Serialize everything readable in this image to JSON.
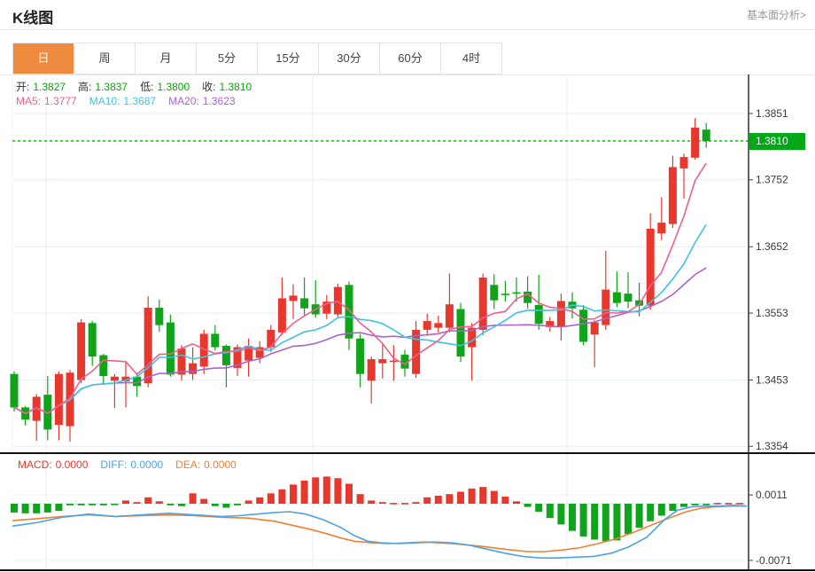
{
  "header": {
    "title": "K线图",
    "link": "基本面分析>"
  },
  "tabs": [
    {
      "label": "日",
      "active": true
    },
    {
      "label": "周",
      "active": false
    },
    {
      "label": "月",
      "active": false
    },
    {
      "label": "5分",
      "active": false
    },
    {
      "label": "15分",
      "active": false
    },
    {
      "label": "30分",
      "active": false
    },
    {
      "label": "60分",
      "active": false
    },
    {
      "label": "4时",
      "active": false
    }
  ],
  "ohlc_items": [
    {
      "label": "开:",
      "value": "1.3827"
    },
    {
      "label": "高:",
      "value": "1.3837"
    },
    {
      "label": "低:",
      "value": "1.3800"
    },
    {
      "label": "收:",
      "value": "1.3810"
    }
  ],
  "ohlc_value_color": "#0aa50a",
  "ma_legend": [
    {
      "label": "MA5:",
      "value": "1.3777",
      "color": "#ef5f8e"
    },
    {
      "label": "MA10:",
      "value": "1.3687",
      "color": "#3fc3e3"
    },
    {
      "label": "MA20:",
      "value": "1.3623",
      "color": "#ab63ce"
    }
  ],
  "macd_legend": [
    {
      "label": "MACD:",
      "value": "0.0000",
      "color": "#e8372c"
    },
    {
      "label": "DIFF:",
      "value": "0.0000",
      "color": "#4da2e8"
    },
    {
      "label": "DEA:",
      "value": "0.0000",
      "color": "#f08030"
    }
  ],
  "price_axis": {
    "labels": [
      "1.3851",
      "1.3752",
      "1.3652",
      "1.3553",
      "1.3453",
      "1.3354"
    ],
    "current_price": "1.3810"
  },
  "macd_axis": {
    "labels": [
      "0.0011",
      "-0.0071"
    ]
  },
  "colors": {
    "up": "#e8382d",
    "down": "#10a41b",
    "ma5": "#ef5f8e",
    "ma10": "#3fc3e3",
    "ma20": "#ab63ce",
    "diff": "#4da2e8",
    "dea": "#f08030",
    "tab_active_bg": "#ee8b3e",
    "price_tag_bg": "#00a716",
    "current_line": "#2eba2e",
    "grid": "#e9eef5",
    "axis": "#222222",
    "zero_line": "#b8dcf5"
  },
  "chart_data": {
    "type": "candlestick",
    "title": "K线图",
    "panes": 2,
    "pane1": {
      "ylabel": "price",
      "y_ticks": [
        1.3851,
        1.3752,
        1.3652,
        1.3553,
        1.3453,
        1.3354
      ],
      "current_price": 1.381,
      "ma_windows": [
        5,
        10,
        20
      ],
      "candles_ohlc": [
        [
          1.3462,
          1.3466,
          1.3406,
          1.3412
        ],
        [
          1.3412,
          1.3414,
          1.3385,
          1.3394
        ],
        [
          1.3392,
          1.3432,
          1.3362,
          1.3428
        ],
        [
          1.3431,
          1.3459,
          1.3363,
          1.3379
        ],
        [
          1.3386,
          1.3466,
          1.3363,
          1.3462
        ],
        [
          1.3384,
          1.3468,
          1.3361,
          1.3464
        ],
        [
          1.3453,
          1.3544,
          1.3448,
          1.3539
        ],
        [
          1.3538,
          1.3541,
          1.3474,
          1.3488
        ],
        [
          1.349,
          1.3492,
          1.3446,
          1.3459
        ],
        [
          1.3452,
          1.3462,
          1.3411,
          1.3458
        ],
        [
          1.3451,
          1.3479,
          1.3412,
          1.3458
        ],
        [
          1.3458,
          1.3464,
          1.3428,
          1.3444
        ],
        [
          1.3448,
          1.3578,
          1.3442,
          1.3561
        ],
        [
          1.3561,
          1.3573,
          1.3525,
          1.3535
        ],
        [
          1.3539,
          1.3551,
          1.3458,
          1.3461
        ],
        [
          1.3461,
          1.3505,
          1.3452,
          1.35
        ],
        [
          1.3462,
          1.3502,
          1.3453,
          1.3478
        ],
        [
          1.3473,
          1.3528,
          1.3462,
          1.3522
        ],
        [
          1.3522,
          1.3535,
          1.3497,
          1.3502
        ],
        [
          1.3504,
          1.3506,
          1.3442,
          1.3475
        ],
        [
          1.3471,
          1.3506,
          1.3459,
          1.3502
        ],
        [
          1.3482,
          1.3515,
          1.3458,
          1.3504
        ],
        [
          1.3486,
          1.3511,
          1.3478,
          1.3502
        ],
        [
          1.3502,
          1.3535,
          1.3495,
          1.3528
        ],
        [
          1.3524,
          1.3606,
          1.352,
          1.3575
        ],
        [
          1.3571,
          1.3596,
          1.3544,
          1.3579
        ],
        [
          1.3575,
          1.3606,
          1.355,
          1.356
        ],
        [
          1.3566,
          1.3602,
          1.3546,
          1.3551
        ],
        [
          1.3552,
          1.358,
          1.3544,
          1.357
        ],
        [
          1.3551,
          1.3597,
          1.3545,
          1.3592
        ],
        [
          1.3595,
          1.36,
          1.3498,
          1.3515
        ],
        [
          1.3515,
          1.3522,
          1.3442,
          1.3462
        ],
        [
          1.3452,
          1.3488,
          1.3418,
          1.3484
        ],
        [
          1.3478,
          1.3506,
          1.3455,
          1.3484
        ],
        [
          1.348,
          1.3505,
          1.3452,
          1.3482
        ],
        [
          1.3491,
          1.3498,
          1.3458,
          1.347
        ],
        [
          1.3462,
          1.3541,
          1.3456,
          1.3528
        ],
        [
          1.3528,
          1.3552,
          1.352,
          1.3541
        ],
        [
          1.3531,
          1.3549,
          1.3524,
          1.3538
        ],
        [
          1.3531,
          1.3612,
          1.3524,
          1.3566
        ],
        [
          1.3559,
          1.3568,
          1.348,
          1.3488
        ],
        [
          1.3502,
          1.3538,
          1.3452,
          1.3531
        ],
        [
          1.3528,
          1.3612,
          1.352,
          1.3606
        ],
        [
          1.3595,
          1.3611,
          1.3559,
          1.3572
        ],
        [
          1.3582,
          1.3601,
          1.357,
          1.358
        ],
        [
          1.3584,
          1.3606,
          1.357,
          1.3582
        ],
        [
          1.3585,
          1.3608,
          1.356,
          1.3568
        ],
        [
          1.3565,
          1.361,
          1.3528,
          1.3537
        ],
        [
          1.3532,
          1.3547,
          1.3525,
          1.3541
        ],
        [
          1.3532,
          1.3582,
          1.3512,
          1.3571
        ],
        [
          1.357,
          1.3584,
          1.3545,
          1.356
        ],
        [
          1.3558,
          1.3565,
          1.3505,
          1.351
        ],
        [
          1.3521,
          1.3542,
          1.3472,
          1.3539
        ],
        [
          1.3535,
          1.3646,
          1.3528,
          1.3588
        ],
        [
          1.3584,
          1.3615,
          1.3562,
          1.3568
        ],
        [
          1.3582,
          1.3614,
          1.356,
          1.357
        ],
        [
          1.3572,
          1.3598,
          1.3548,
          1.3564
        ],
        [
          1.3564,
          1.3702,
          1.3558,
          1.3679
        ],
        [
          1.3672,
          1.3726,
          1.3662,
          1.3688
        ],
        [
          1.3686,
          1.3788,
          1.368,
          1.3771
        ],
        [
          1.3769,
          1.3791,
          1.3724,
          1.3786
        ],
        [
          1.3785,
          1.3844,
          1.3782,
          1.383
        ],
        [
          1.3827,
          1.3837,
          1.38,
          1.381
        ]
      ]
    },
    "pane2": {
      "indicator": "MACD",
      "y_ticks": [
        0.0011,
        -0.0071
      ],
      "hist_1e4": [
        -11,
        -12,
        -12,
        -11,
        -9,
        -2,
        -2,
        -2,
        -2,
        -1,
        4,
        2,
        8,
        3,
        -2,
        -3,
        13,
        6,
        -3,
        -5,
        -2,
        4,
        8,
        13,
        18,
        24,
        29,
        33,
        34,
        32,
        25,
        12,
        4,
        2,
        1,
        1,
        2,
        8,
        10,
        12,
        15,
        19,
        21,
        16,
        9,
        3,
        -4,
        -10,
        -18,
        -26,
        -34,
        -41,
        -45,
        -47,
        -46,
        -38,
        -30,
        -22,
        -15,
        -9,
        -4,
        -2,
        -1,
        1,
        1,
        1
      ],
      "diff_points_1e4": [
        [
          14,
          -28
        ],
        [
          40,
          -24
        ],
        [
          70,
          -17
        ],
        [
          100,
          -13
        ],
        [
          130,
          -16
        ],
        [
          160,
          -14
        ],
        [
          190,
          -12
        ],
        [
          220,
          -14
        ],
        [
          250,
          -16
        ],
        [
          270,
          -15
        ],
        [
          290,
          -13
        ],
        [
          310,
          -11
        ],
        [
          327,
          -10
        ],
        [
          345,
          -13
        ],
        [
          365,
          -20
        ],
        [
          385,
          -30
        ],
        [
          400,
          -40
        ],
        [
          415,
          -47
        ],
        [
          430,
          -49
        ],
        [
          450,
          -50
        ],
        [
          470,
          -49
        ],
        [
          490,
          -48
        ],
        [
          510,
          -49
        ],
        [
          530,
          -52
        ],
        [
          550,
          -57
        ],
        [
          570,
          -62
        ],
        [
          590,
          -66
        ],
        [
          610,
          -68
        ],
        [
          630,
          -68
        ],
        [
          650,
          -67
        ],
        [
          670,
          -66
        ],
        [
          690,
          -62
        ],
        [
          710,
          -54
        ],
        [
          730,
          -42
        ],
        [
          750,
          -20
        ],
        [
          765,
          -8
        ],
        [
          780,
          -4
        ],
        [
          797,
          -3
        ],
        [
          812,
          -3
        ],
        [
          828,
          -2
        ],
        [
          843,
          -3
        ]
      ],
      "dea_points_1e4": [
        [
          14,
          -21
        ],
        [
          40,
          -19
        ],
        [
          70,
          -16
        ],
        [
          100,
          -14
        ],
        [
          130,
          -16
        ],
        [
          160,
          -15
        ],
        [
          190,
          -14
        ],
        [
          220,
          -15
        ],
        [
          250,
          -17
        ],
        [
          280,
          -18
        ],
        [
          310,
          -22
        ],
        [
          330,
          -27
        ],
        [
          350,
          -32
        ],
        [
          370,
          -38
        ],
        [
          385,
          -43
        ],
        [
          400,
          -47
        ],
        [
          420,
          -49
        ],
        [
          440,
          -50
        ],
        [
          460,
          -49
        ],
        [
          480,
          -48
        ],
        [
          510,
          -50
        ],
        [
          540,
          -53
        ],
        [
          570,
          -57
        ],
        [
          595,
          -60
        ],
        [
          615,
          -60
        ],
        [
          635,
          -58
        ],
        [
          655,
          -55
        ],
        [
          675,
          -50
        ],
        [
          695,
          -44
        ],
        [
          715,
          -36
        ],
        [
          735,
          -27
        ],
        [
          755,
          -18
        ],
        [
          775,
          -10
        ],
        [
          790,
          -6
        ],
        [
          805,
          -4
        ],
        [
          825,
          -3
        ],
        [
          843,
          -3
        ]
      ]
    }
  }
}
